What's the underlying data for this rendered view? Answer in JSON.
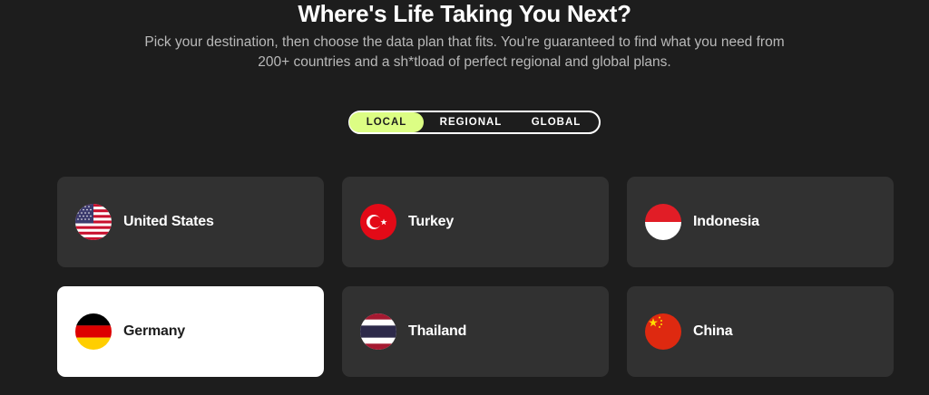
{
  "header": {
    "title": "Where's Life Taking You Next?",
    "subtitle_line1": "Pick your destination, then choose the data plan that fits. You're guaranteed to find what you need from",
    "subtitle_line2": "200+ countries and a sh*tload of perfect regional and global plans."
  },
  "tabs": [
    {
      "label": "LOCAL",
      "active": true
    },
    {
      "label": "REGIONAL",
      "active": false
    },
    {
      "label": "GLOBAL",
      "active": false
    }
  ],
  "colors": {
    "background": "#1d1d1d",
    "card": "#313131",
    "card_selected": "#ffffff",
    "accent": "#dcfd84"
  },
  "countries": [
    {
      "name": "United States",
      "flag": "us-flag-icon",
      "selected": false
    },
    {
      "name": "Turkey",
      "flag": "turkey-flag-icon",
      "selected": false
    },
    {
      "name": "Indonesia",
      "flag": "indonesia-flag-icon",
      "selected": false
    },
    {
      "name": "Germany",
      "flag": "germany-flag-icon",
      "selected": true
    },
    {
      "name": "Thailand",
      "flag": "thailand-flag-icon",
      "selected": false
    },
    {
      "name": "China",
      "flag": "china-flag-icon",
      "selected": false
    }
  ]
}
